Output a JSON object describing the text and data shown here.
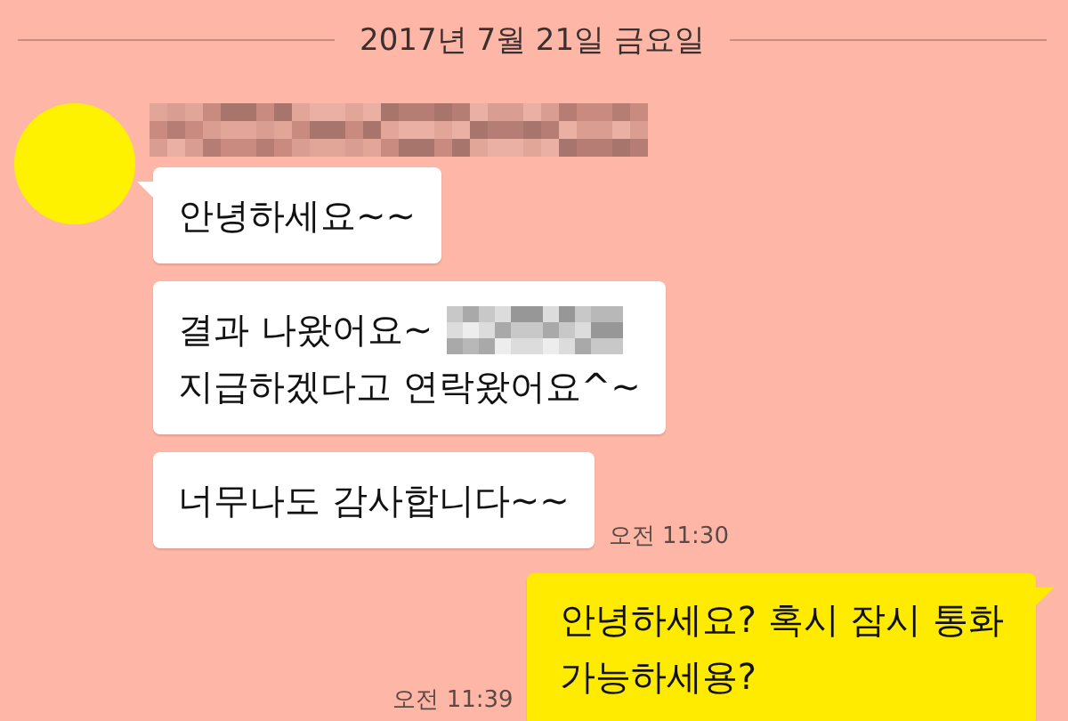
{
  "date_divider": "2017년 7월 21일 금요일",
  "incoming": {
    "sender_redacted": true,
    "messages": [
      {
        "lines": [
          {
            "text": "안녕하세요~~"
          }
        ]
      },
      {
        "lines": [
          {
            "text": "결과 나왔어요~",
            "redacted": true
          },
          {
            "text": "지급하겠다고 연락왔어요^~"
          }
        ]
      },
      {
        "lines": [
          {
            "text": "너무나도 감사합니다~~"
          }
        ],
        "time": "오전 11:30"
      }
    ]
  },
  "outgoing": {
    "messages": [
      {
        "lines": [
          {
            "text": "안녕하세요? 혹시 잠시 통화"
          },
          {
            "text": "가능하세용?"
          }
        ],
        "time": "오전 11:39"
      }
    ]
  }
}
